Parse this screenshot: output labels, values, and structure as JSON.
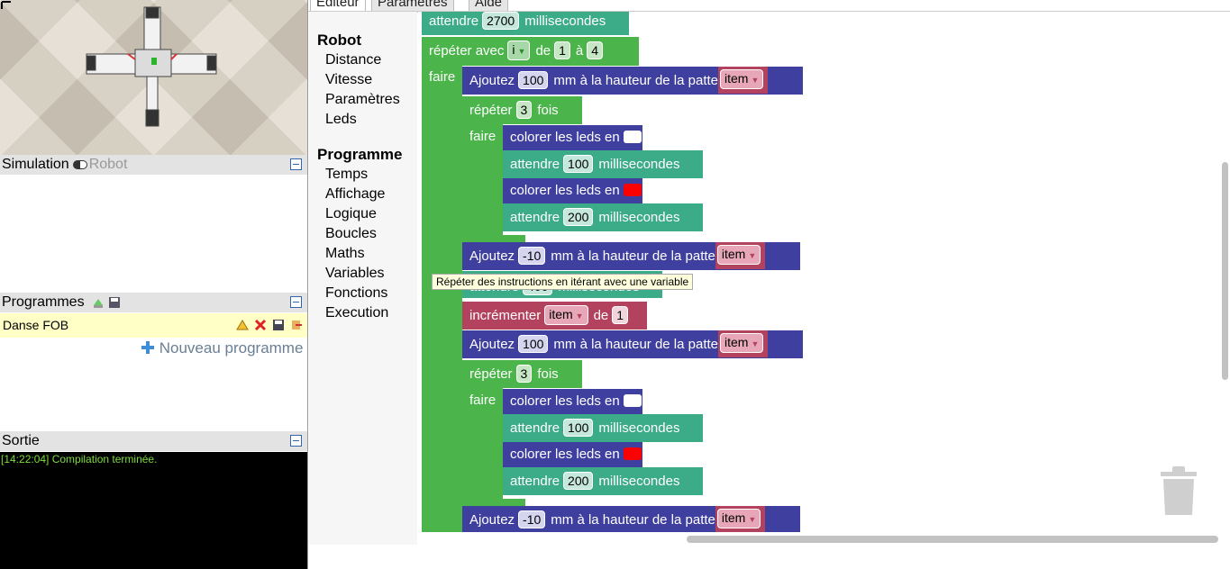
{
  "tabs": [
    "Editeur",
    "Paramètres",
    "Aide"
  ],
  "simulation": {
    "title": "Simulation",
    "robot_label": "Robot"
  },
  "programmes": {
    "title": "Programmes",
    "items": [
      "Danse FOB"
    ],
    "new_label": "Nouveau programme"
  },
  "sortie": {
    "title": "Sortie",
    "log": "[14:22:04] Compilation terminée."
  },
  "toolbox": {
    "robot_head": "Robot",
    "robot_items": [
      "Distance",
      "Vitesse",
      "Paramètres",
      "Leds"
    ],
    "prog_head": "Programme",
    "prog_items": [
      "Temps",
      "Affichage",
      "Logique",
      "Boucles",
      "Maths",
      "Variables",
      "Fonctions",
      "Execution"
    ]
  },
  "blocks": {
    "attendre": "attendre",
    "ms": "millisecondes",
    "wait_top": "2700",
    "repeter_avec": "répéter avec",
    "loop_var": "i",
    "de": "de",
    "a": "à",
    "from": "1",
    "to": "4",
    "faire": "faire",
    "ajoutez": "Ajoutez",
    "mm_text": "mm à la hauteur de la patte",
    "item": "item",
    "repeter": "répéter",
    "fois": "fois",
    "times": "3",
    "colorer": "colorer les leds en",
    "add_up": "100",
    "add_down": "-10",
    "wait_short": "100",
    "wait_long": "200",
    "hidden_wait": "400",
    "incrementer": "incrémenter",
    "inc_by": "1"
  },
  "colors": {
    "white_led": "#ffffff",
    "red_led": "#ff0000"
  },
  "tooltip": "Répéter des instructions en itérant avec une variable"
}
